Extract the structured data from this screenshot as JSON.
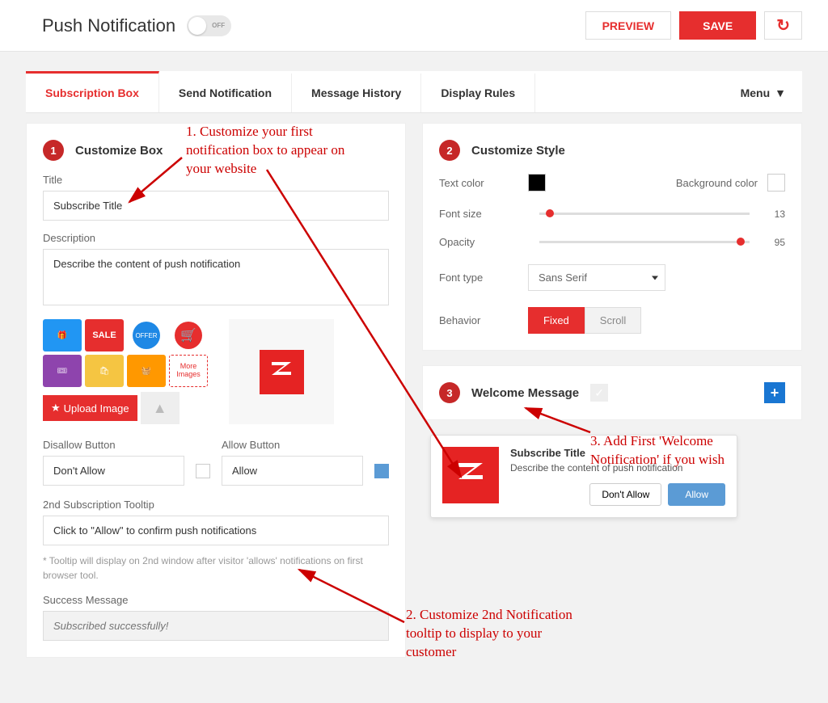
{
  "header": {
    "title": "Push Notification",
    "toggle_state": "OFF",
    "preview_btn": "PREVIEW",
    "save_btn": "SAVE"
  },
  "tabs": {
    "items": [
      "Subscription Box",
      "Send Notification",
      "Message History",
      "Display Rules"
    ],
    "menu": "Menu"
  },
  "box": {
    "step_num": "1",
    "step_title": "Customize Box",
    "title_label": "Title",
    "title_value": "Subscribe Title",
    "desc_label": "Description",
    "desc_value": "Describe the content of push notification",
    "more_images": "More Images",
    "upload_btn": "Upload Image",
    "disallow_label": "Disallow Button",
    "disallow_value": "Don't Allow",
    "allow_label": "Allow Button",
    "allow_value": "Allow",
    "tooltip_label": "2nd Subscription Tooltip",
    "tooltip_value": "Click to \"Allow\" to confirm push notifications",
    "tooltip_help": "* Tooltip will display on 2nd window after visitor 'allows' notifications on first browser tool.",
    "success_label": "Success Message",
    "success_placeholder": "Subscribed successfully!"
  },
  "style": {
    "step_num": "2",
    "step_title": "Customize Style",
    "text_color_label": "Text color",
    "text_color": "#000000",
    "bg_color_label": "Background color",
    "bg_color": "#ffffff",
    "font_size_label": "Font size",
    "font_size_value": "13",
    "opacity_label": "Opacity",
    "opacity_value": "95",
    "font_type_label": "Font type",
    "font_type_value": "Sans Serif",
    "behavior_label": "Behavior",
    "behavior_fixed": "Fixed",
    "behavior_scroll": "Scroll"
  },
  "welcome": {
    "step_num": "3",
    "step_title": "Welcome Message"
  },
  "preview": {
    "title": "Subscribe Title",
    "desc": "Describe the content of push notification",
    "dont_allow": "Don't Allow",
    "allow": "Allow"
  },
  "annotations": {
    "a1": "1. Customize your first notification box to appear on your website",
    "a2": "2. Customize 2nd Notification tooltip to display to your customer",
    "a3": "3. Add First 'Welcome Notification' if you wish"
  }
}
